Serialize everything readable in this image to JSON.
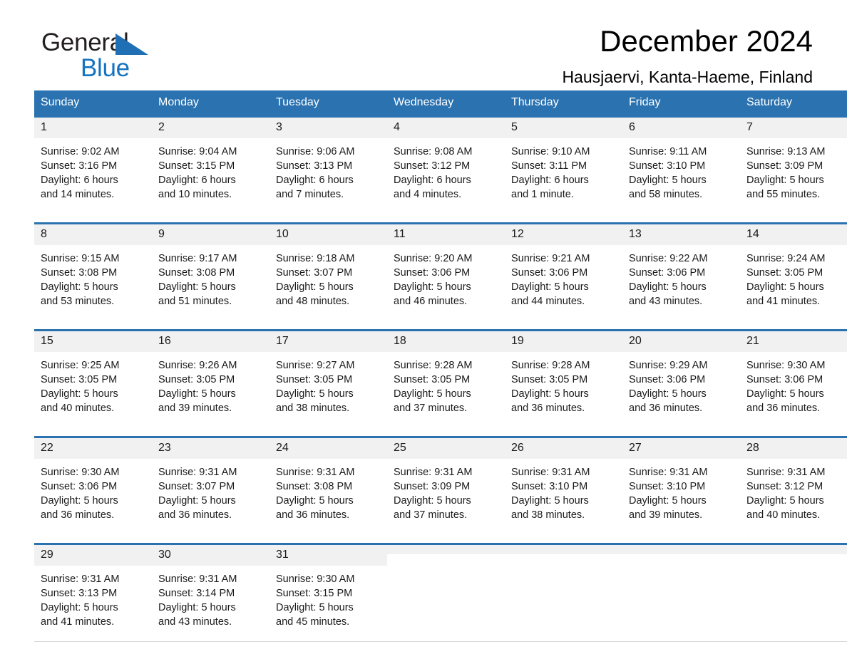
{
  "brand": {
    "line1": "General",
    "line2": "Blue",
    "triangle_icon": "triangle-icon",
    "accent_color": "#1573bf"
  },
  "header": {
    "title": "December 2024",
    "subtitle": "Hausjaervi, Kanta-Haeme, Finland"
  },
  "theme": {
    "header_blue": "#2b72b0",
    "daynum_band": "#f1f1f1",
    "text": "#1a1a1a"
  },
  "calendar": {
    "weekday_headers": [
      "Sunday",
      "Monday",
      "Tuesday",
      "Wednesday",
      "Thursday",
      "Friday",
      "Saturday"
    ],
    "weeks": [
      [
        {
          "day": "1",
          "info": "Sunrise: 9:02 AM\nSunset: 3:16 PM\nDaylight: 6 hours\nand 14 minutes."
        },
        {
          "day": "2",
          "info": "Sunrise: 9:04 AM\nSunset: 3:15 PM\nDaylight: 6 hours\nand 10 minutes."
        },
        {
          "day": "3",
          "info": "Sunrise: 9:06 AM\nSunset: 3:13 PM\nDaylight: 6 hours\nand 7 minutes."
        },
        {
          "day": "4",
          "info": "Sunrise: 9:08 AM\nSunset: 3:12 PM\nDaylight: 6 hours\nand 4 minutes."
        },
        {
          "day": "5",
          "info": "Sunrise: 9:10 AM\nSunset: 3:11 PM\nDaylight: 6 hours\nand 1 minute."
        },
        {
          "day": "6",
          "info": "Sunrise: 9:11 AM\nSunset: 3:10 PM\nDaylight: 5 hours\nand 58 minutes."
        },
        {
          "day": "7",
          "info": "Sunrise: 9:13 AM\nSunset: 3:09 PM\nDaylight: 5 hours\nand 55 minutes."
        }
      ],
      [
        {
          "day": "8",
          "info": "Sunrise: 9:15 AM\nSunset: 3:08 PM\nDaylight: 5 hours\nand 53 minutes."
        },
        {
          "day": "9",
          "info": "Sunrise: 9:17 AM\nSunset: 3:08 PM\nDaylight: 5 hours\nand 51 minutes."
        },
        {
          "day": "10",
          "info": "Sunrise: 9:18 AM\nSunset: 3:07 PM\nDaylight: 5 hours\nand 48 minutes."
        },
        {
          "day": "11",
          "info": "Sunrise: 9:20 AM\nSunset: 3:06 PM\nDaylight: 5 hours\nand 46 minutes."
        },
        {
          "day": "12",
          "info": "Sunrise: 9:21 AM\nSunset: 3:06 PM\nDaylight: 5 hours\nand 44 minutes."
        },
        {
          "day": "13",
          "info": "Sunrise: 9:22 AM\nSunset: 3:06 PM\nDaylight: 5 hours\nand 43 minutes."
        },
        {
          "day": "14",
          "info": "Sunrise: 9:24 AM\nSunset: 3:05 PM\nDaylight: 5 hours\nand 41 minutes."
        }
      ],
      [
        {
          "day": "15",
          "info": "Sunrise: 9:25 AM\nSunset: 3:05 PM\nDaylight: 5 hours\nand 40 minutes."
        },
        {
          "day": "16",
          "info": "Sunrise: 9:26 AM\nSunset: 3:05 PM\nDaylight: 5 hours\nand 39 minutes."
        },
        {
          "day": "17",
          "info": "Sunrise: 9:27 AM\nSunset: 3:05 PM\nDaylight: 5 hours\nand 38 minutes."
        },
        {
          "day": "18",
          "info": "Sunrise: 9:28 AM\nSunset: 3:05 PM\nDaylight: 5 hours\nand 37 minutes."
        },
        {
          "day": "19",
          "info": "Sunrise: 9:28 AM\nSunset: 3:05 PM\nDaylight: 5 hours\nand 36 minutes."
        },
        {
          "day": "20",
          "info": "Sunrise: 9:29 AM\nSunset: 3:06 PM\nDaylight: 5 hours\nand 36 minutes."
        },
        {
          "day": "21",
          "info": "Sunrise: 9:30 AM\nSunset: 3:06 PM\nDaylight: 5 hours\nand 36 minutes."
        }
      ],
      [
        {
          "day": "22",
          "info": "Sunrise: 9:30 AM\nSunset: 3:06 PM\nDaylight: 5 hours\nand 36 minutes."
        },
        {
          "day": "23",
          "info": "Sunrise: 9:31 AM\nSunset: 3:07 PM\nDaylight: 5 hours\nand 36 minutes."
        },
        {
          "day": "24",
          "info": "Sunrise: 9:31 AM\nSunset: 3:08 PM\nDaylight: 5 hours\nand 36 minutes."
        },
        {
          "day": "25",
          "info": "Sunrise: 9:31 AM\nSunset: 3:09 PM\nDaylight: 5 hours\nand 37 minutes."
        },
        {
          "day": "26",
          "info": "Sunrise: 9:31 AM\nSunset: 3:10 PM\nDaylight: 5 hours\nand 38 minutes."
        },
        {
          "day": "27",
          "info": "Sunrise: 9:31 AM\nSunset: 3:10 PM\nDaylight: 5 hours\nand 39 minutes."
        },
        {
          "day": "28",
          "info": "Sunrise: 9:31 AM\nSunset: 3:12 PM\nDaylight: 5 hours\nand 40 minutes."
        }
      ],
      [
        {
          "day": "29",
          "info": "Sunrise: 9:31 AM\nSunset: 3:13 PM\nDaylight: 5 hours\nand 41 minutes."
        },
        {
          "day": "30",
          "info": "Sunrise: 9:31 AM\nSunset: 3:14 PM\nDaylight: 5 hours\nand 43 minutes."
        },
        {
          "day": "31",
          "info": "Sunrise: 9:30 AM\nSunset: 3:15 PM\nDaylight: 5 hours\nand 45 minutes."
        },
        {
          "day": "",
          "info": ""
        },
        {
          "day": "",
          "info": ""
        },
        {
          "day": "",
          "info": ""
        },
        {
          "day": "",
          "info": ""
        }
      ]
    ]
  }
}
